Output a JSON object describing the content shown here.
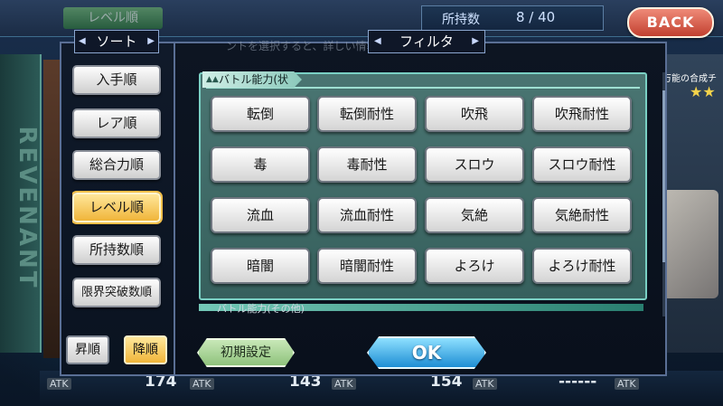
{
  "header": {
    "tab_level": "レベル順",
    "owned_label": "所持数",
    "owned_value": "8 / 40",
    "back_label": "BACK"
  },
  "side_banner": {
    "text": "REVENANT"
  },
  "background_card": {
    "text": "万能の合成チ",
    "stars": "★★"
  },
  "hint_text": "ントを選択すると、詳しい情報",
  "sort": {
    "title": "ソート",
    "items": [
      {
        "label": "入手順",
        "active": false
      },
      {
        "label": "レア順",
        "active": false
      },
      {
        "label": "総合力順",
        "active": false
      },
      {
        "label": "レベル順",
        "active": true
      },
      {
        "label": "所持数順",
        "active": false
      },
      {
        "label": "限界突破数順",
        "active": false
      }
    ],
    "asc_label": "昇順",
    "desc_label": "降順"
  },
  "filter": {
    "title": "フィルタ",
    "section1_label": "バトル能力(状態)",
    "section2_label": "バトル能力(その他)",
    "buttons": [
      "転倒",
      "転倒耐性",
      "吹飛",
      "吹飛耐性",
      "毒",
      "毒耐性",
      "スロウ",
      "スロウ耐性",
      "流血",
      "流血耐性",
      "気絶",
      "気絶耐性",
      "暗闇",
      "暗闇耐性",
      "よろけ",
      "よろけ耐性"
    ],
    "reset_label": "初期設定",
    "ok_label": "OK"
  },
  "bottom_stats": {
    "atk_label": "ATK",
    "values": [
      "174",
      "143",
      "154",
      "------"
    ]
  }
}
